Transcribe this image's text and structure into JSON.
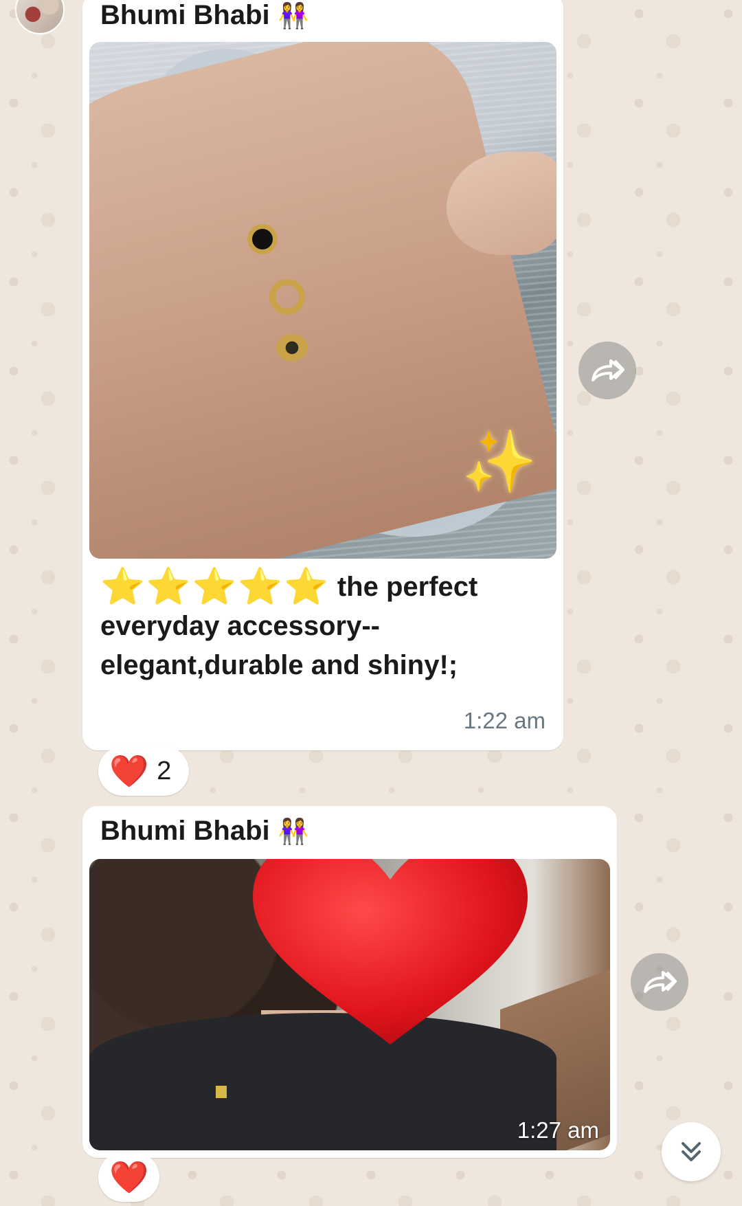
{
  "messages": [
    {
      "sender": "Bhumi Bhabi",
      "sender_emoji": "👭",
      "caption_stars": "⭐⭐⭐⭐⭐",
      "caption_text": " the perfect everyday accessory--elegant,durable and shiny!;",
      "photo_sticker": "✨",
      "time": "1:22 am",
      "reaction": {
        "emoji": "❤️",
        "count": "2"
      }
    },
    {
      "sender": "Bhumi Bhabi",
      "sender_emoji": "👭",
      "photo_sticker": "❤️",
      "time": "1:27 am",
      "reaction": {
        "emoji": "❤️"
      }
    }
  ],
  "icons": {
    "forward": "forward-icon",
    "scroll_down": "double-chevron-down-icon"
  },
  "colors": {
    "chat_background": "#efe7de",
    "bubble": "#ffffff",
    "timestamp": "#667781",
    "heart": "#e5232e"
  }
}
